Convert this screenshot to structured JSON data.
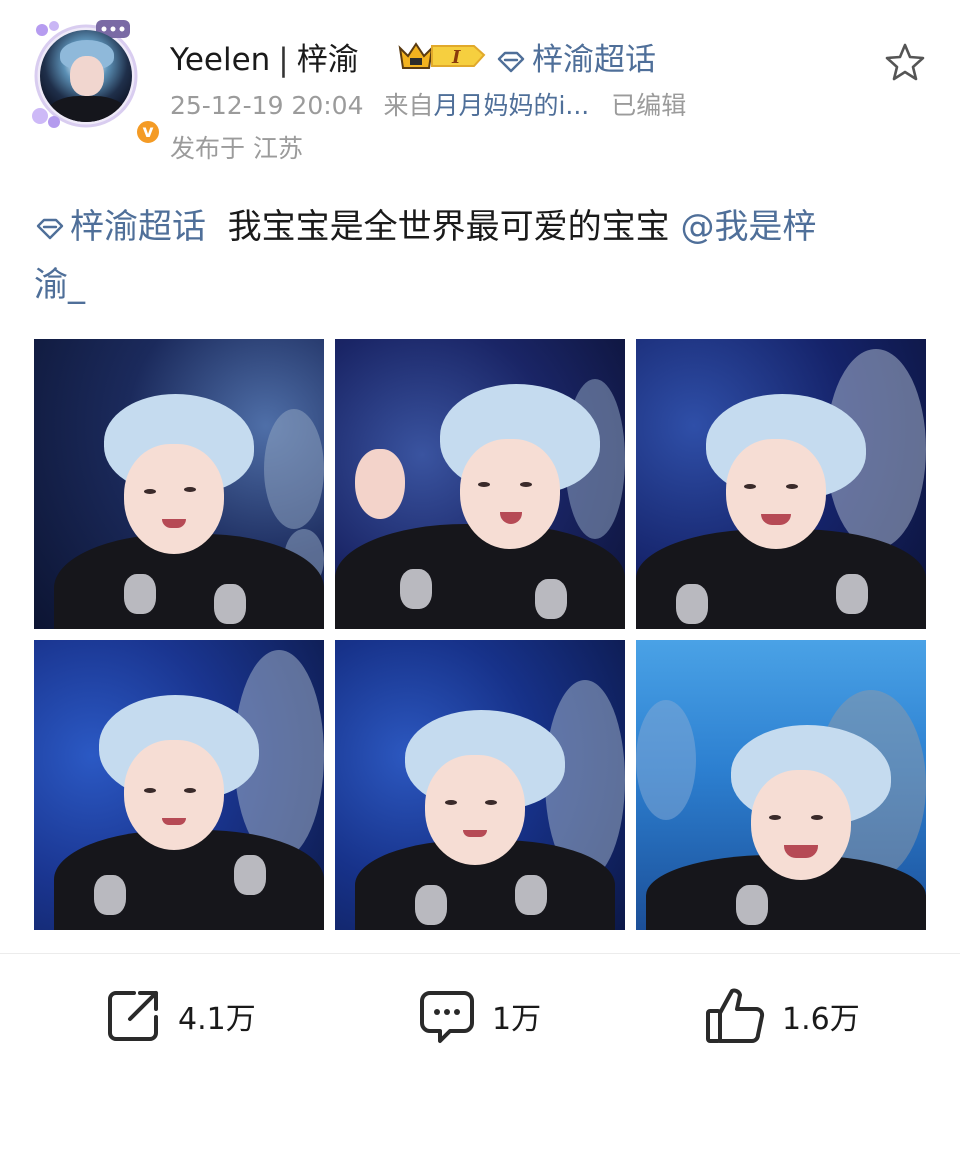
{
  "post": {
    "author": {
      "name": "Yeelen",
      "separator": "|",
      "alias": "梓渝",
      "verified_badge": "v-badge-icon",
      "level_badge": "I"
    },
    "topic_link": "梓渝超话",
    "timestamp": "25-12-19 20:04",
    "source_prefix": "来自",
    "source": "月月妈妈的i...",
    "edited": "已编辑",
    "location": "发布于 江苏",
    "content": {
      "topic": "梓渝超话",
      "text": "我宝宝是全世界最可爱的宝宝",
      "mention_line1": "@我是梓",
      "mention_line2": "渝_"
    },
    "photos": [
      {
        "icon": "photo-1"
      },
      {
        "icon": "photo-2"
      },
      {
        "icon": "photo-3"
      },
      {
        "icon": "photo-4"
      },
      {
        "icon": "photo-5"
      },
      {
        "icon": "photo-6"
      }
    ],
    "actions": {
      "share_count": "4.1万",
      "comment_count": "1万",
      "like_count": "1.6万"
    }
  },
  "colors": {
    "link": "#4f6f99",
    "meta": "#9b9b9b",
    "badge_orange": "#f49b25"
  }
}
